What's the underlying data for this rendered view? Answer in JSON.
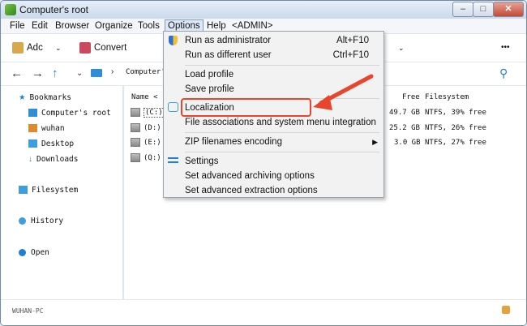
{
  "window": {
    "title": "Computer's root"
  },
  "menubar": [
    "File",
    "Edit",
    "Browser",
    "Organize",
    "Tools",
    "Options",
    "Help",
    "<ADMIN>"
  ],
  "toolbar": {
    "add_label": "Adc",
    "convert_label": "Convert",
    "more_label": "•••"
  },
  "address": {
    "path": "Computer's"
  },
  "sidebar": {
    "bookmarks": "Bookmarks",
    "items": [
      "Computer's root",
      "wuhan",
      "Desktop",
      "Downloads"
    ],
    "filesystem": "Filesystem",
    "history": "History",
    "open": "Open"
  },
  "content": {
    "columns": {
      "name": "Name",
      "free": "Free",
      "filesystem": "Filesystem"
    },
    "rows": [
      {
        "name": "(C:)",
        "free": "49.7 GB",
        "fs": "NTFS, 39% free"
      },
      {
        "name": "(D:)",
        "free": "25.2 GB",
        "fs": "NTFS, 26% free"
      },
      {
        "name": "(E:)",
        "free": "3.0 GB",
        "fs": "NTFS, 27% free"
      },
      {
        "name": "(Q:)",
        "free": "",
        "fs": ""
      }
    ]
  },
  "dropdown": {
    "run_admin": "Run as administrator",
    "run_admin_shortcut": "Alt+F10",
    "run_different": "Run as different user",
    "run_different_shortcut": "Ctrl+F10",
    "load_profile": "Load profile",
    "save_profile": "Save profile",
    "localization": "Localization",
    "file_assoc": "File associations and system menu integration",
    "zip_encoding": "ZIP filenames encoding",
    "settings": "Settings",
    "archiving": "Set advanced archiving options",
    "extraction": "Set advanced extraction options"
  },
  "status": {
    "computer": "WUHAN-PC"
  },
  "colors": {
    "accent": "#1f7fd6",
    "highlight": "#e8452c"
  }
}
